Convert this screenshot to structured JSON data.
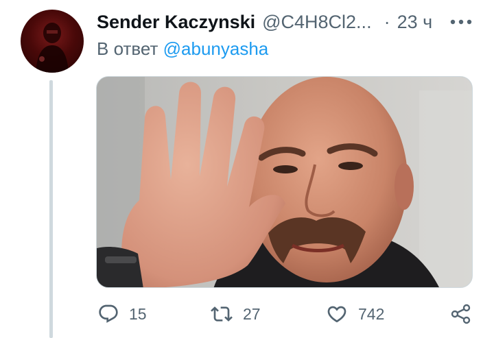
{
  "tweet": {
    "author": {
      "display_name": "Sender Kaczynski",
      "handle": "@C4H8Cl2..."
    },
    "separator": "·",
    "time": "23 ч",
    "reply_prefix": "В ответ",
    "reply_to": "@abunyasha",
    "media": {
      "icon": "photo"
    },
    "actions": {
      "reply_count": "15",
      "retweet_count": "27",
      "like_count": "742"
    },
    "colors": {
      "accent": "#1d9bf0",
      "muted": "#536471",
      "thread_line": "#cfd9de"
    }
  }
}
